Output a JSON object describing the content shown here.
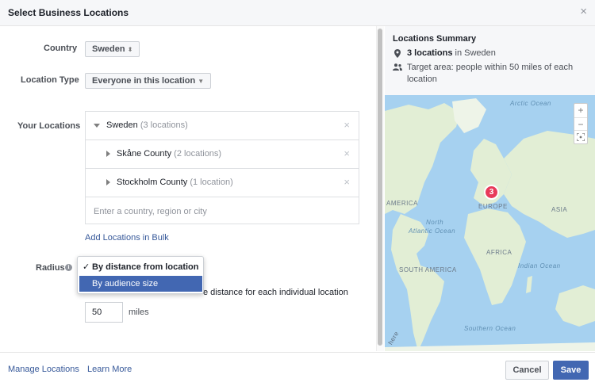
{
  "dialog": {
    "title": "Select Business Locations",
    "close_glyph": "×"
  },
  "form": {
    "country_label": "Country",
    "country_value": "Sweden",
    "location_type_label": "Location Type",
    "location_type_value": "Everyone in this location",
    "your_locations_label": "Your Locations",
    "locations": [
      {
        "name": "Sweden",
        "count": "(3 locations)",
        "expanded": true
      },
      {
        "name": "Skåne County",
        "count": "(2 locations)",
        "expanded": false
      },
      {
        "name": "Stockholm County",
        "count": "(1 location)",
        "expanded": false
      }
    ],
    "location_input_placeholder": "Enter a country, region or city",
    "add_bulk_link": "Add Locations in Bulk",
    "radius_label": "Radius",
    "radius_options": [
      "By distance from location",
      "By audience size"
    ],
    "radius_selected": "By distance from location",
    "radius_highlighted": "By audience size",
    "radius_description_visible": "e distance for each individual location",
    "radius_value": "50",
    "radius_unit": "miles"
  },
  "summary": {
    "title": "Locations Summary",
    "count_bold": "3 locations",
    "count_rest": " in Sweden",
    "target_line1": "Target area: people within 50 miles of each",
    "target_line2": "location"
  },
  "map": {
    "labels": {
      "arctic": "Arctic Ocean",
      "america": "AMERICA",
      "europe": "EUROPE",
      "asia": "ASIA",
      "north_atlantic_1": "North",
      "north_atlantic_2": "Atlantic Ocean",
      "africa": "AFRICA",
      "south_america": "SOUTH AMERICA",
      "indian": "Indian Ocean",
      "southern": "Southern Ocean",
      "here": "here"
    },
    "marker_count": "3",
    "zoom_in": "+",
    "zoom_out": "−"
  },
  "footer": {
    "manage_locations": "Manage Locations",
    "learn_more": "Learn More",
    "cancel": "Cancel",
    "save": "Save"
  },
  "colors": {
    "accent": "#4267b2",
    "marker": "#e83a5a",
    "water": "#a6d1f0",
    "land": "#e2eed5"
  }
}
